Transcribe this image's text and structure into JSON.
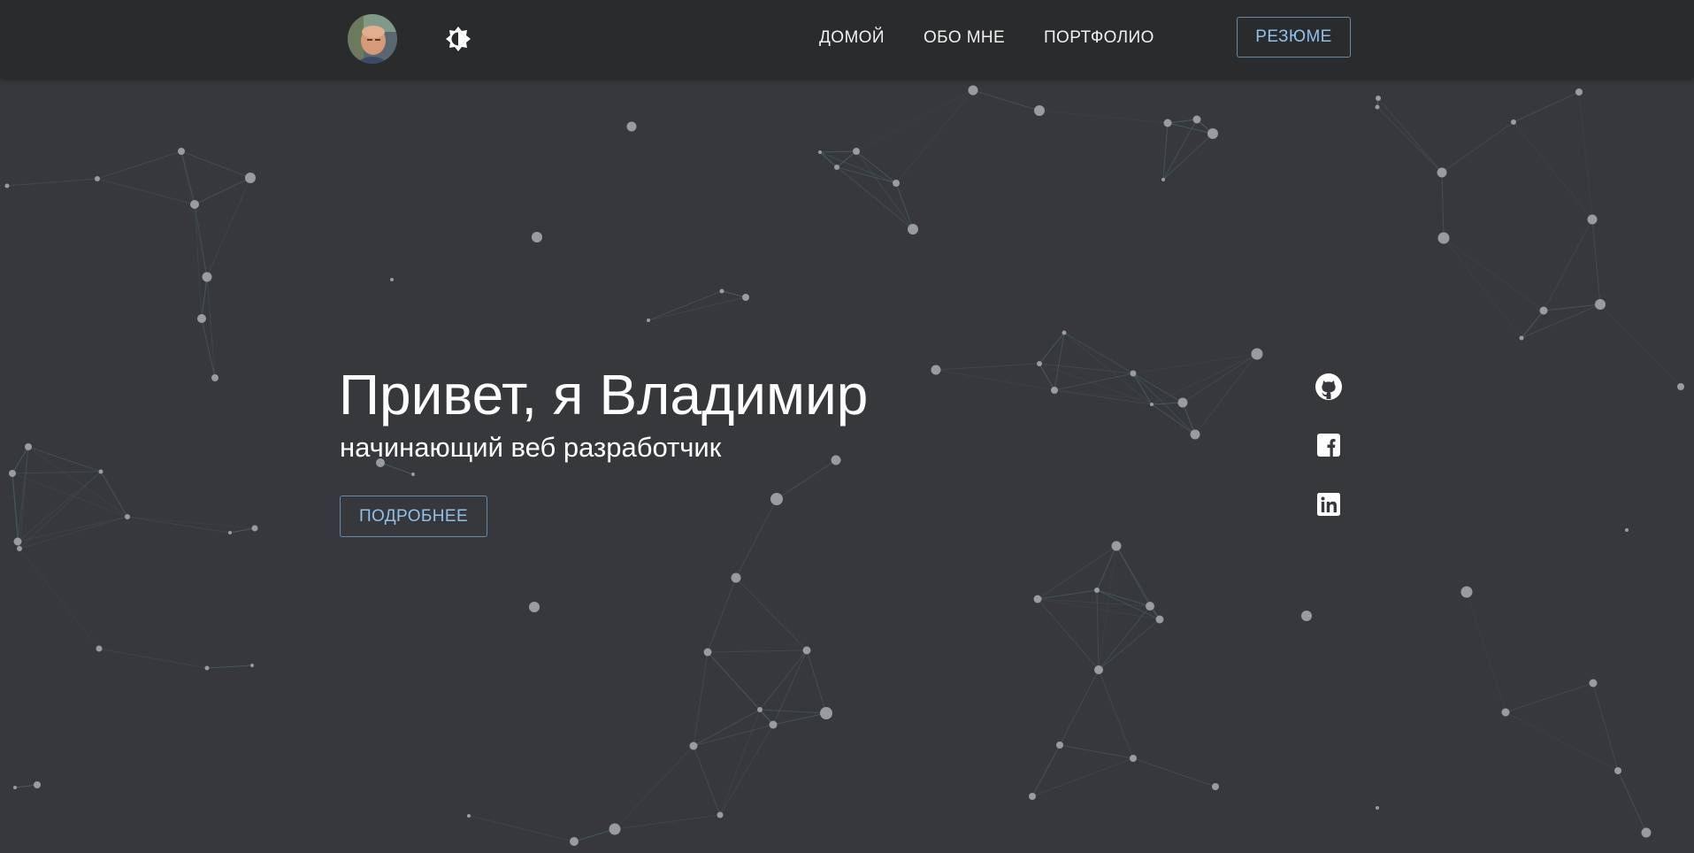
{
  "nav": {
    "avatar_alt": "Владимир",
    "theme_toggle_icon": "brightness-icon",
    "links": [
      {
        "label": "ДОМОЙ"
      },
      {
        "label": "ОБО МНЕ"
      },
      {
        "label": "ПОРТФОЛИО"
      }
    ],
    "resume_label": "РЕЗЮМЕ"
  },
  "hero": {
    "title": "Привет, я Владимир",
    "subtitle": "начинающий веб разработчик",
    "button_label": "ПОДРОБНЕЕ"
  },
  "social": [
    {
      "icon": "github-icon"
    },
    {
      "icon": "facebook-icon"
    },
    {
      "icon": "linkedin-icon"
    }
  ],
  "colors": {
    "background": "#36383c",
    "navbar": "#2a2b2d",
    "accent": "#8fc1ea",
    "particle": "#a4a6a9",
    "particle_line": "#4f6d6a"
  }
}
